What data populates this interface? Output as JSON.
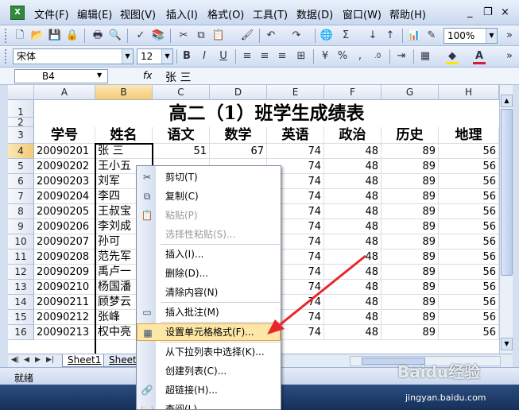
{
  "menubar": {
    "items": [
      "文件(F)",
      "编辑(E)",
      "视图(V)",
      "插入(I)",
      "格式(O)",
      "工具(T)",
      "数据(D)",
      "窗口(W)",
      "帮助(H)"
    ],
    "app_icon": "excel-icon",
    "minimize": "_",
    "restore": "❐",
    "close": "×"
  },
  "toolbar": {
    "zoom": "100%",
    "font": "宋体",
    "font_size": "12",
    "bold": "B",
    "italic": "I",
    "underline": "U",
    "percent": "%",
    "comma": ",",
    "accent_fill": "#ffe600",
    "accent_font": "#d4202a"
  },
  "formula": {
    "cell_ref": "B4",
    "fx": "fx",
    "content": "张  三"
  },
  "sheet": {
    "columns": [
      "A",
      "B",
      "C",
      "D",
      "E",
      "F",
      "G",
      "H"
    ],
    "rows": [
      "1",
      "2",
      "3",
      "4",
      "5",
      "6",
      "7",
      "8",
      "9",
      "10",
      "11",
      "12",
      "13",
      "14",
      "15",
      "16"
    ],
    "title": "高二（1）班学生成绩表",
    "headers": [
      "学号",
      "姓名",
      "语文",
      "数学",
      "英语",
      "政治",
      "历史",
      "地理"
    ],
    "data": [
      {
        "id": "20090201",
        "name": "张  三",
        "c": "51",
        "d": "67",
        "e": "74",
        "f": "48",
        "g": "89",
        "h": "56"
      },
      {
        "id": "20090202",
        "name": "王小五",
        "e": "74",
        "f": "48",
        "g": "89",
        "h": "56"
      },
      {
        "id": "20090203",
        "name": "刘军",
        "e": "74",
        "f": "48",
        "g": "89",
        "h": "56"
      },
      {
        "id": "20090204",
        "name": "李四",
        "e": "74",
        "f": "48",
        "g": "89",
        "h": "56"
      },
      {
        "id": "20090205",
        "name": "王叔宝",
        "e": "74",
        "f": "48",
        "g": "89",
        "h": "56"
      },
      {
        "id": "20090206",
        "name": "李刘成",
        "e": "74",
        "f": "48",
        "g": "89",
        "h": "56"
      },
      {
        "id": "20090207",
        "name": "孙可",
        "e": "74",
        "f": "48",
        "g": "89",
        "h": "56"
      },
      {
        "id": "20090208",
        "name": "范先军",
        "e": "74",
        "f": "48",
        "g": "89",
        "h": "56"
      },
      {
        "id": "20090209",
        "name": "禹卢一",
        "e": "74",
        "f": "48",
        "g": "89",
        "h": "56"
      },
      {
        "id": "20090210",
        "name": "杨国潘",
        "e": "74",
        "f": "48",
        "g": "89",
        "h": "56"
      },
      {
        "id": "20090211",
        "name": "顾梦云",
        "e": "74",
        "f": "48",
        "g": "89",
        "h": "56"
      },
      {
        "id": "20090212",
        "name": "张峰",
        "e": "74",
        "f": "48",
        "g": "89",
        "h": "56"
      },
      {
        "id": "20090213",
        "name": "权中亮",
        "e": "74",
        "f": "48",
        "g": "89",
        "h": "56"
      }
    ],
    "tabs": [
      "Sheet1",
      "Sheet"
    ]
  },
  "status": {
    "text": "就绪"
  },
  "context_menu": {
    "items": [
      {
        "label": "剪切(T)",
        "icon": "cut-icon",
        "glyph": "✂",
        "disabled": false
      },
      {
        "label": "复制(C)",
        "icon": "copy-icon",
        "glyph": "⧉",
        "disabled": false
      },
      {
        "label": "粘贴(P)",
        "icon": "paste-icon",
        "glyph": "📋",
        "disabled": true
      },
      {
        "label": "选择性粘贴(S)...",
        "icon": "",
        "glyph": "",
        "disabled": true
      },
      {
        "label": "插入(I)...",
        "icon": "",
        "glyph": "",
        "disabled": false
      },
      {
        "label": "删除(D)...",
        "icon": "",
        "glyph": "",
        "disabled": false
      },
      {
        "label": "清除内容(N)",
        "icon": "",
        "glyph": "",
        "disabled": false
      },
      {
        "label": "插入批注(M)",
        "icon": "comment-icon",
        "glyph": "▭",
        "disabled": false
      },
      {
        "label": "设置单元格格式(F)...",
        "icon": "format-cells-icon",
        "glyph": "▦",
        "disabled": false,
        "highlighted": true
      },
      {
        "label": "从下拉列表中选择(K)...",
        "icon": "",
        "glyph": "",
        "disabled": false
      },
      {
        "label": "创建列表(C)...",
        "icon": "",
        "glyph": "",
        "disabled": false
      },
      {
        "label": "超链接(H)...",
        "icon": "hyperlink-icon",
        "glyph": "🔗",
        "disabled": false
      },
      {
        "label": "查阅(L)...",
        "icon": "lookup-icon",
        "glyph": "📖",
        "disabled": false
      }
    ]
  },
  "annotation": {
    "arrow_color": "#e8262d"
  },
  "watermark": {
    "brand": "Baidu经验",
    "url": "jingyan.baidu.com"
  }
}
